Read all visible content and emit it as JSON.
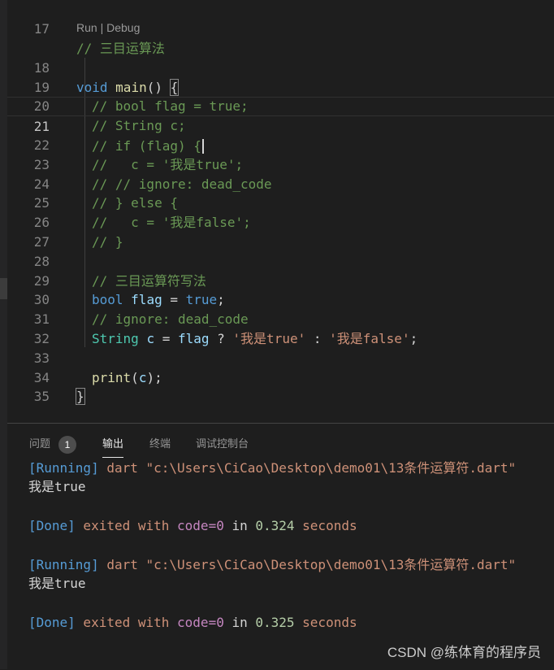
{
  "editor": {
    "line_numbers": [
      "17",
      "18",
      "19",
      "20",
      "21",
      "22",
      "23",
      "24",
      "25",
      "26",
      "27",
      "28",
      "29",
      "30",
      "31",
      "32",
      "33",
      "34",
      "35"
    ],
    "codelens": {
      "run": "Run",
      "sep": " | ",
      "debug": "Debug"
    },
    "lines": {
      "l17": "// 三目运算法",
      "l18_void": "void",
      "l18_main": "main",
      "l18_parens": "() ",
      "l18_brace": "{",
      "l19": "// bool flag = true;",
      "l20": "// String c;",
      "l21": "// if (flag) {",
      "l22": "//   c = '我是true';",
      "l23": "// // ignore: dead_code",
      "l24": "// } else {",
      "l25": "//   c = '我是false';",
      "l26": "// }",
      "l28": "// 三目运算符写法",
      "l29_bool": "bool",
      "l29_flag": "flag",
      "l29_eq": " = ",
      "l29_true": "true",
      "l29_semi": ";",
      "l30": "// ignore: dead_code",
      "l31_string": "String",
      "l31_c": "c",
      "l31_eq": " = ",
      "l31_flag": "flag",
      "l31_q": " ? ",
      "l31_s1": "'我是true'",
      "l31_colon": " : ",
      "l31_s2": "'我是false'",
      "l31_semi": ";",
      "l33_print": "print",
      "l33_open": "(",
      "l33_c": "c",
      "l33_close": ");",
      "l34": "}"
    }
  },
  "panel": {
    "tabs": {
      "problems": "问题",
      "problems_count": "1",
      "output": "输出",
      "terminal": "终端",
      "debug_console": "调试控制台"
    },
    "runs": [
      {
        "running": "[Running]",
        "cmd": " dart \"c:\\Users\\CiCao\\Desktop\\demo01\\13条件运算符.dart\"",
        "result": "我是true",
        "done": "[Done]",
        "exited": " exited with ",
        "code": "code=0",
        "in": " in ",
        "time": "0.324",
        "seconds": " seconds"
      },
      {
        "running": "[Running]",
        "cmd": " dart \"c:\\Users\\CiCao\\Desktop\\demo01\\13条件运算符.dart\"",
        "result": "我是true",
        "done": "[Done]",
        "exited": " exited with ",
        "code": "code=0",
        "in": " in ",
        "time": "0.325",
        "seconds": " seconds"
      }
    ]
  },
  "watermark": "CSDN @练体育的程序员",
  "colors": {
    "background": "#1e1e1e",
    "comment": "#6a9955",
    "keyword": "#569cd6",
    "string": "#ce9178",
    "variable": "#9cdcfe",
    "function": "#dcdcaa"
  }
}
